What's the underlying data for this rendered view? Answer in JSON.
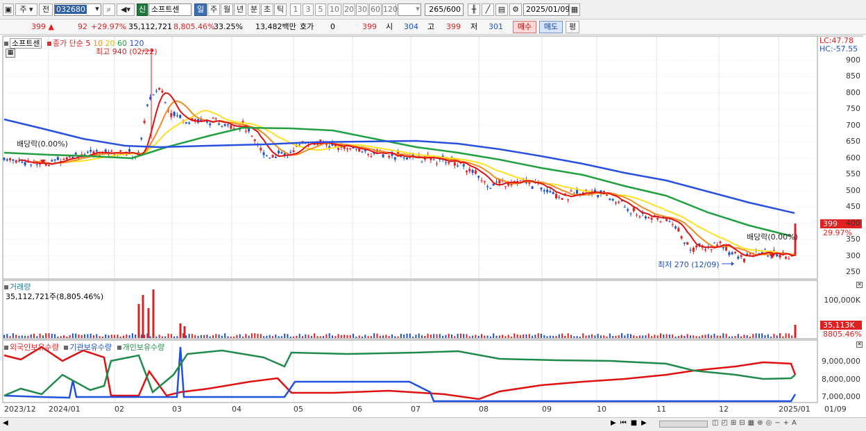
{
  "toolbar": {
    "market": "주",
    "prev": "전",
    "code": "032680",
    "buy_badge": "신",
    "stock_name": "소프트센",
    "periods": [
      "일",
      "주",
      "월",
      "년",
      "분",
      "초",
      "틱"
    ],
    "selected_period": "일",
    "intervals": [
      "1",
      "3",
      "5",
      "10",
      "20",
      "30",
      "60",
      "120"
    ],
    "count": "265",
    "count_total": "/600",
    "date": "2025/01/09"
  },
  "quote": {
    "price": "399",
    "change": "92",
    "change_pct": "+29.97%",
    "volume": "35,112,721",
    "volume_pct": "8,805.46%",
    "turnover": "33.25%",
    "amount": "13,482백만",
    "hoga_label": "호가",
    "hoga_val": "0",
    "hoga_price": "399",
    "open_label": "시",
    "open": "304",
    "high_label": "고",
    "high": "399",
    "low_label": "저",
    "low": "301",
    "buy": "매수",
    "sell": "매도",
    "flat": "평"
  },
  "price_panel": {
    "legend_name": "소프트센",
    "legend_ma": "종가 단순",
    "ma_periods": [
      "5",
      "10",
      "20",
      "60",
      "120"
    ],
    "high_annot": "최고 940 (02/22)",
    "low_annot": "최저 270 (12/09)",
    "div_left": "배당락(0.00%)",
    "div_right": "배당락(0.00%)",
    "lc": "LC:47.78",
    "hc": "HC:-57.55",
    "last_price": "399",
    "last_pct": "29.97%",
    "yticks": [
      "900",
      "850",
      "800",
      "750",
      "700",
      "650",
      "600",
      "550",
      "500",
      "450",
      "400",
      "350",
      "300",
      "250"
    ]
  },
  "volume_panel": {
    "title": "거래량",
    "value": "35,112,721주(8,805.46%)",
    "ytick": "100,000K",
    "last": "35,113K",
    "last_pct": "8805.46%"
  },
  "holder_panel": {
    "foreign": "외국인보유수량",
    "inst": "기관보유수량",
    "indiv": "개인보유수량",
    "yticks": [
      "9,000,000",
      "8,000,000",
      "7,000,000"
    ]
  },
  "xaxis": [
    "2023/12",
    "2024/01",
    "02",
    "03",
    "04",
    "05",
    "06",
    "07",
    "08",
    "09",
    "10",
    "11",
    "12",
    "2025/01",
    "01/09"
  ],
  "colors": {
    "ma5": "#e01010",
    "ma10": "#f08a20",
    "ma20": "#ffe020",
    "ma60": "#20a040",
    "ma120": "#2850e0",
    "up": "#e02020",
    "down": "#2050c0"
  }
}
